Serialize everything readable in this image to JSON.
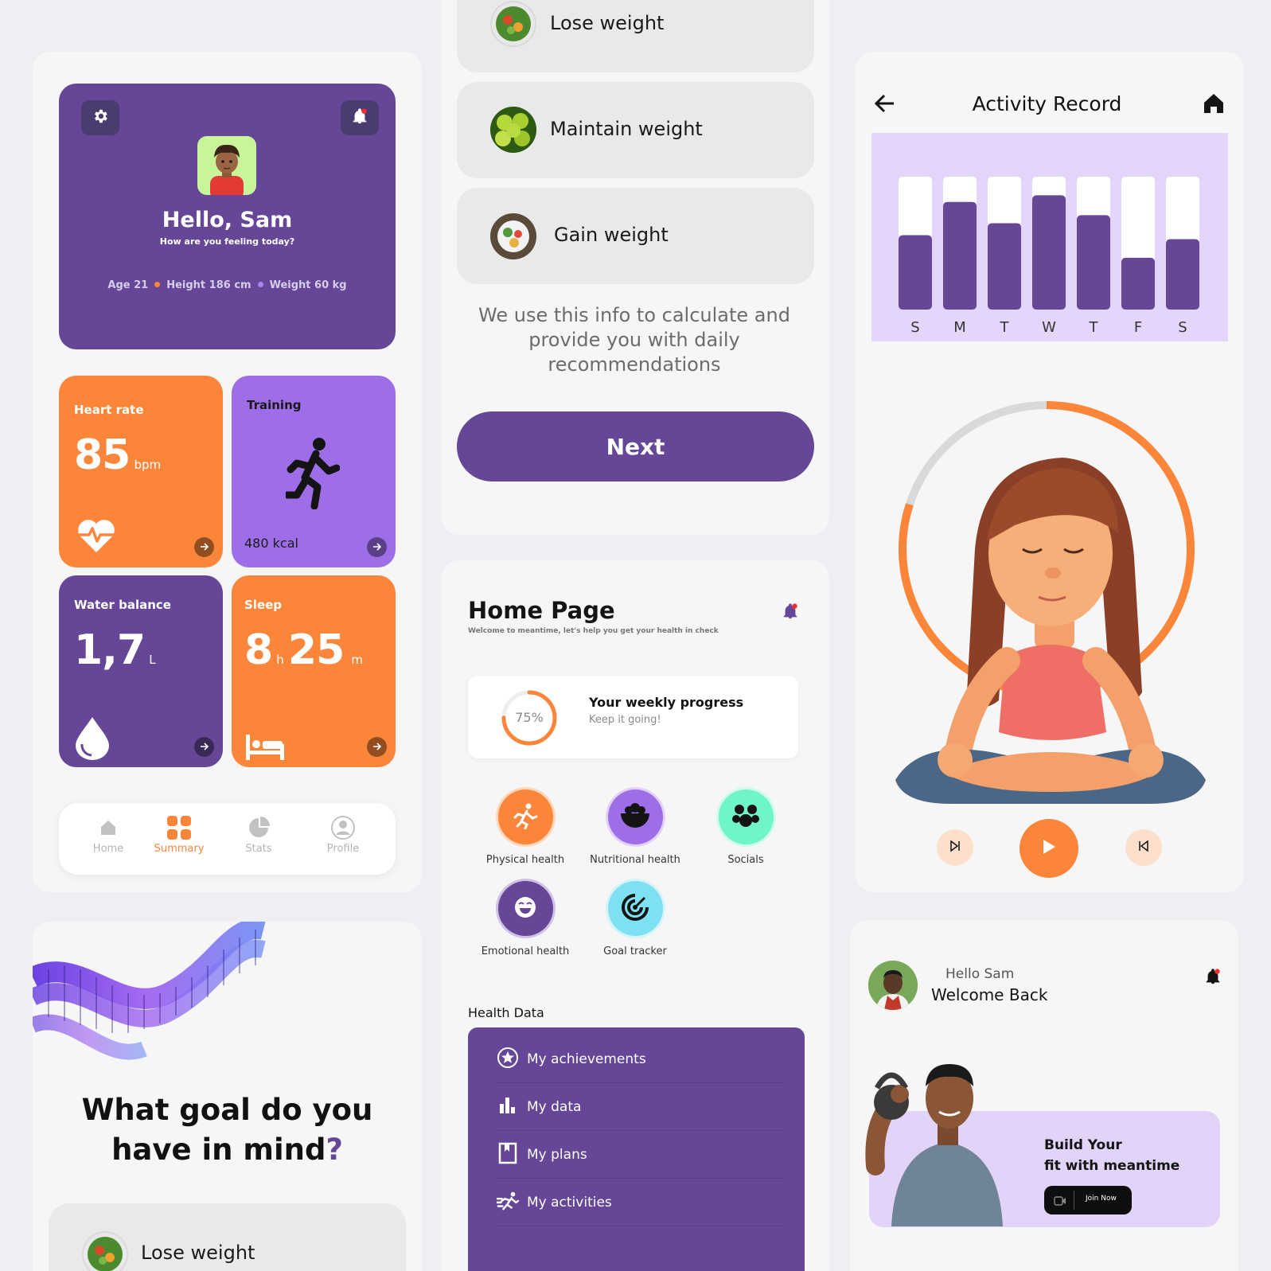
{
  "colors": {
    "purple": "#654697",
    "orange": "#fb863a",
    "lilac": "#9d6ee8",
    "mint": "#6ff5c8",
    "sky": "#7fe0f2"
  },
  "profile": {
    "greeting": "Hello, Sam",
    "subtitle": "How are you feeling today?",
    "age": "Age 21",
    "height": "Height 186 cm",
    "weight": "Weight 60 kg",
    "icons": {
      "settings": "gear-icon",
      "notifications": "bell-icon"
    }
  },
  "tiles": {
    "heart": {
      "title": "Heart rate",
      "value": "85",
      "unit": "bpm"
    },
    "training": {
      "title": "Training",
      "kcal": "480 kcal"
    },
    "water": {
      "title": "Water balance",
      "value": "1,7",
      "unit": "L"
    },
    "sleep": {
      "title": "Sleep",
      "hours": "8",
      "h_unit": "h",
      "minutes": "25",
      "m_unit": "m"
    }
  },
  "nav": {
    "items": [
      {
        "label": "Home",
        "icon": "home-icon",
        "active": false
      },
      {
        "label": "Summary",
        "icon": "grid-icon",
        "active": true
      },
      {
        "label": "Stats",
        "icon": "pie-chart-icon",
        "active": false
      },
      {
        "label": "Profile",
        "icon": "user-icon",
        "active": false
      }
    ]
  },
  "goal": {
    "question_line1": "What goal do you",
    "question_line2": "have in mind",
    "question_mark": "?",
    "options": [
      "Lose weight",
      "Maintain weight",
      "Gain weight"
    ],
    "info": "We use this info to calculate and provide you with daily recommendations",
    "next": "Next"
  },
  "home": {
    "title": "Home Page",
    "subtitle": "Welcome to meantime, let's help you get your health in check",
    "progress_title": "Your weekly progress",
    "progress_sub": "Keep it going!",
    "progress_value": "75%",
    "progress_fraction": 0.75,
    "categories": [
      {
        "label": "Physical health",
        "icon": "running-icon"
      },
      {
        "label": "Nutritional health",
        "icon": "bowl-icon"
      },
      {
        "label": "Socials",
        "icon": "people-icon"
      },
      {
        "label": "Emotional health",
        "icon": "smile-icon"
      },
      {
        "label": "Goal tracker",
        "icon": "target-icon"
      }
    ],
    "health_title": "Health Data",
    "health_items": [
      {
        "label": "My achievements",
        "icon": "star-badge-icon"
      },
      {
        "label": "My data",
        "icon": "bar-chart-icon"
      },
      {
        "label": "My plans",
        "icon": "bookmark-icon"
      },
      {
        "label": "My activities",
        "icon": "running-icon"
      }
    ]
  },
  "activity": {
    "title": "Activity Record",
    "ring_progress": 0.8,
    "chart_data": {
      "type": "bar",
      "categories": [
        "S",
        "M",
        "T",
        "W",
        "T",
        "F",
        "S"
      ],
      "values": [
        56,
        81,
        65,
        86,
        71,
        39,
        53
      ],
      "ylim": [
        0,
        100
      ]
    }
  },
  "welcome": {
    "hello": "Hello Sam",
    "title": "Welcome Back",
    "promo_line1": "Build Your",
    "promo_line2": "fit with meantime",
    "join": "Join Now"
  }
}
